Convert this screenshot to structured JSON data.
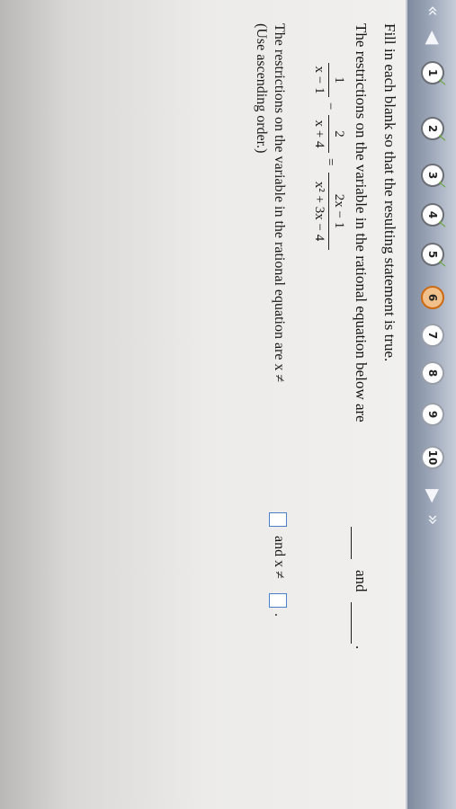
{
  "nav": {
    "back_first_icon": "double-chevron-left-icon",
    "back_icon": "chevron-left-icon",
    "forward_icon": "chevron-right-icon",
    "forward_last_icon": "double-chevron-right-icon",
    "questions": [
      {
        "label": "1",
        "state": "done"
      },
      {
        "label": "2",
        "state": "done"
      },
      {
        "label": "3",
        "state": "done"
      },
      {
        "label": "4",
        "state": "done"
      },
      {
        "label": "5",
        "state": "done"
      },
      {
        "label": "6",
        "state": "current"
      },
      {
        "label": "7",
        "state": "todo"
      },
      {
        "label": "8",
        "state": "todo"
      },
      {
        "label": "9",
        "state": "todo"
      },
      {
        "label": "10",
        "state": "todo"
      }
    ],
    "check_glyph": "✓"
  },
  "problem": {
    "instruction": "Fill in each blank so that the resulting statement is true.",
    "statement": "The restrictions on the variable in the rational equation below are",
    "and_text": "and",
    "period": ".",
    "equation": {
      "frac1": {
        "num": "1",
        "den": "x − 1"
      },
      "minus": "−",
      "frac2": {
        "num": "2",
        "den": "x + 4"
      },
      "equals": "=",
      "frac3": {
        "num": "2x − 1",
        "den": "x² + 3x − 4"
      }
    },
    "answer_prompt": "The restrictions on the variable in the rational equation are x ≠",
    "answer_and": "and x ≠",
    "answer_period": ".",
    "hint": "(Use ascending order.)",
    "answer1": "",
    "answer2": ""
  },
  "colors": {
    "current_question": "#f2c08a",
    "check": "#6aa63a",
    "answer_box": "#4a7fc9"
  }
}
